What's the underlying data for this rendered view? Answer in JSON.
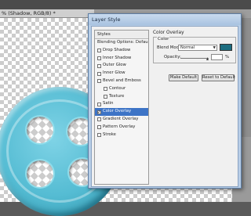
{
  "document_tab": {
    "title": "% (Shadow, RGB/8) *"
  },
  "dialog": {
    "title": "Layer Style",
    "styles_header": "Styles",
    "styles": [
      {
        "label": "Blending Options: Default",
        "checkbox": false,
        "checked": false,
        "indent": false,
        "selected": false
      },
      {
        "label": "Drop Shadow",
        "checkbox": true,
        "checked": false,
        "indent": false,
        "selected": false
      },
      {
        "label": "Inner Shadow",
        "checkbox": true,
        "checked": false,
        "indent": false,
        "selected": false
      },
      {
        "label": "Outer Glow",
        "checkbox": true,
        "checked": false,
        "indent": false,
        "selected": false
      },
      {
        "label": "Inner Glow",
        "checkbox": true,
        "checked": false,
        "indent": false,
        "selected": false
      },
      {
        "label": "Bevel and Emboss",
        "checkbox": true,
        "checked": false,
        "indent": false,
        "selected": false
      },
      {
        "label": "Contour",
        "checkbox": true,
        "checked": false,
        "indent": true,
        "selected": false
      },
      {
        "label": "Texture",
        "checkbox": true,
        "checked": false,
        "indent": true,
        "selected": false
      },
      {
        "label": "Satin",
        "checkbox": true,
        "checked": false,
        "indent": false,
        "selected": false
      },
      {
        "label": "Color Overlay",
        "checkbox": true,
        "checked": true,
        "indent": false,
        "selected": true
      },
      {
        "label": "Gradient Overlay",
        "checkbox": true,
        "checked": false,
        "indent": false,
        "selected": false
      },
      {
        "label": "Pattern Overlay",
        "checkbox": true,
        "checked": false,
        "indent": false,
        "selected": false
      },
      {
        "label": "Stroke",
        "checkbox": true,
        "checked": false,
        "indent": false,
        "selected": false
      }
    ],
    "panel": {
      "title": "Color Overlay",
      "group_label": "Color",
      "blend_mode_label": "Blend Mode:",
      "blend_mode_value": "Normal",
      "overlay_color": "#1c6d80",
      "opacity_label": "Opacity:",
      "opacity_value": "",
      "opacity_unit": "%",
      "make_default_label": "Make Default",
      "reset_default_label": "Reset to Default"
    }
  }
}
